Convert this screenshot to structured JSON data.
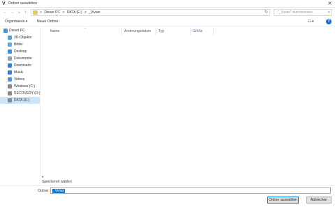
{
  "window": {
    "title": "Ordner auswählen",
    "close_glyph": "✕"
  },
  "address": {
    "breadcrumbs": [
      "Dieser PC",
      "DATA (E:)",
      "_Vivian"
    ],
    "separator": ">",
    "search_placeholder": "\"_Vivian\" durchsuchen"
  },
  "toolbar": {
    "organize_label": "Organisieren ▾",
    "new_folder_label": "Neuer Ordner",
    "view_label": "☷ ▾",
    "help_label": "?"
  },
  "sidebar": {
    "items": [
      {
        "label": "Dieser PC",
        "icon": "computer-icon",
        "color": "#4a8fd6"
      },
      {
        "label": "3D-Objekte",
        "icon": "cube-icon",
        "color": "#4aa3df"
      },
      {
        "label": "Bilder",
        "icon": "pictures-icon",
        "color": "#6aa7d9"
      },
      {
        "label": "Desktop",
        "icon": "desktop-icon",
        "color": "#3e8fe0"
      },
      {
        "label": "Dokumente",
        "icon": "documents-icon",
        "color": "#8aa0b8"
      },
      {
        "label": "Downloads",
        "icon": "download-icon",
        "color": "#2a82da"
      },
      {
        "label": "Musik",
        "icon": "music-icon",
        "color": "#3a7fd0"
      },
      {
        "label": "Videos",
        "icon": "video-icon",
        "color": "#5a8fd0"
      },
      {
        "label": "Windows (C:)",
        "icon": "drive-icon",
        "color": "#8a8a8a"
      },
      {
        "label": "RECOVERY (D:)",
        "icon": "drive-icon",
        "color": "#8a8a8a"
      },
      {
        "label": "DATA (E:)",
        "icon": "drive-icon",
        "color": "#8a8a8a"
      }
    ]
  },
  "columns": [
    "Name",
    "Änderungsdatum",
    "Typ",
    "Größe"
  ],
  "status": {
    "empty_text": "Speicherort wählen"
  },
  "folder_field": {
    "label": "Ordner:",
    "value": "_Vivian"
  },
  "buttons": {
    "select_label": "Ordner auswählen",
    "cancel_label": "Abbrechen"
  },
  "colors": {
    "accent": "#0078d7",
    "selected_bg": "#cce4f7"
  }
}
